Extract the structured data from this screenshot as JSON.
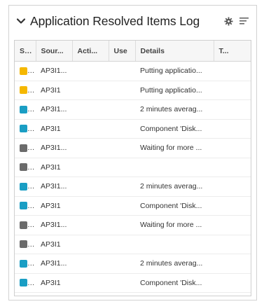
{
  "panel": {
    "title": "Application Resolved Items Log",
    "icons": {
      "collapse": "chevron-down-icon",
      "settings": "gear-icon",
      "menu": "menu-lines-icon"
    }
  },
  "table": {
    "columns": [
      "S...",
      "Sour...",
      "Acti...",
      "Use",
      "Details",
      "T..."
    ],
    "rows": [
      {
        "status": "yellow",
        "source": "AP3I1...",
        "action": "",
        "user": "",
        "details": "Putting applicatio...",
        "time": ""
      },
      {
        "status": "yellow",
        "source": "AP3I1",
        "action": "",
        "user": "",
        "details": "Putting applicatio...",
        "time": ""
      },
      {
        "status": "blue",
        "source": "AP3I1...",
        "action": "",
        "user": "",
        "details": "2 minutes averag...",
        "time": ""
      },
      {
        "status": "blue",
        "source": "AP3I1",
        "action": "",
        "user": "",
        "details": "Component 'Disk...",
        "time": ""
      },
      {
        "status": "gray",
        "source": "AP3I1...",
        "action": "",
        "user": "",
        "details": "Waiting for more ...",
        "time": ""
      },
      {
        "status": "gray",
        "source": "AP3I1",
        "action": "",
        "user": "",
        "details": "",
        "time": ""
      },
      {
        "status": "blue",
        "source": "AP3I1...",
        "action": "",
        "user": "",
        "details": "2 minutes averag...",
        "time": ""
      },
      {
        "status": "blue",
        "source": "AP3I1",
        "action": "",
        "user": "",
        "details": "Component 'Disk...",
        "time": ""
      },
      {
        "status": "gray",
        "source": "AP3I1...",
        "action": "",
        "user": "",
        "details": "Waiting for more ...",
        "time": ""
      },
      {
        "status": "gray",
        "source": "AP3I1",
        "action": "",
        "user": "",
        "details": "",
        "time": ""
      },
      {
        "status": "blue",
        "source": "AP3I1...",
        "action": "",
        "user": "",
        "details": "2 minutes averag...",
        "time": ""
      },
      {
        "status": "blue",
        "source": "AP3I1",
        "action": "",
        "user": "",
        "details": "Component 'Disk...",
        "time": ""
      }
    ]
  },
  "colors": {
    "yellow": "#f5b800",
    "blue": "#1a9ec4",
    "gray": "#6b6b6b"
  }
}
